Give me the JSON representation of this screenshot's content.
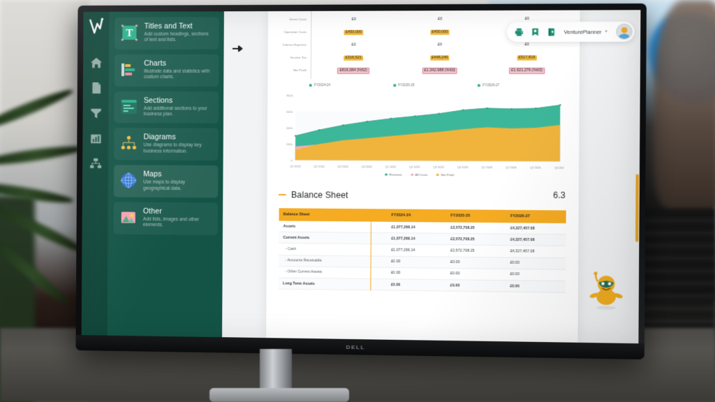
{
  "monitor": {
    "brand": "DELL"
  },
  "sidebar": {
    "rail_icons": [
      "logo-icon",
      "home-icon",
      "document-icon",
      "funnel-icon",
      "bar-chart-icon",
      "org-chart-icon"
    ],
    "items": [
      {
        "title": "Titles and Text",
        "desc": "Add custom headings, sections of text and lists.",
        "icon": "title-block-icon",
        "active": false
      },
      {
        "title": "Charts",
        "desc": "Illustrate data and statistics with custom charts.",
        "icon": "bar-chart-icon",
        "active": false
      },
      {
        "title": "Sections",
        "desc": "Add additional sections to your business plan.",
        "icon": "sections-icon",
        "active": false
      },
      {
        "title": "Diagrams",
        "desc": "Use diagrams to display key business information.",
        "icon": "diagram-icon",
        "active": false
      },
      {
        "title": "Maps",
        "desc": "Use maps to display geographical data.",
        "icon": "globe-icon",
        "active": true
      },
      {
        "title": "Other",
        "desc": "Add lists, images and other elements.",
        "icon": "image-icon",
        "active": false
      }
    ],
    "collapse_label": "‹"
  },
  "toolbar": {
    "print_icon": "printer-icon",
    "save_icon": "save-icon",
    "book_icon": "book-icon",
    "workspace_name": "VenturePlanner",
    "caret": "▾",
    "avatar": "user-avatar"
  },
  "financials": {
    "rows": [
      {
        "label": "Direct Costs",
        "values": [
          "£0",
          "£0",
          "£0"
        ],
        "style": [
          "plain",
          "plain",
          "plain"
        ]
      },
      {
        "label": "Operation Costs",
        "values": [
          "£450,000",
          "£450,000",
          "£0"
        ],
        "style": [
          "amber",
          "amber",
          "plain"
        ]
      },
      {
        "label": "Interest Expense",
        "values": [
          "£0",
          "£0",
          "£0"
        ],
        "style": [
          "plain",
          "plain",
          "plain"
        ]
      },
      {
        "label": "Income Tax",
        "values": [
          "£316,521",
          "£448,246",
          "£517,819"
        ],
        "style": [
          "amber",
          "amber",
          "amber"
        ]
      },
      {
        "label": "Net Profit",
        "values": [
          "£816,084 (%52)",
          "£1,342,988 (%60)",
          "£1,621,276 (%63)"
        ],
        "style": [
          "pink",
          "pink",
          "pink"
        ]
      }
    ]
  },
  "year_legend": [
    {
      "label": "FY2024-24",
      "color": "#2fae84"
    },
    {
      "label": "FY2025-25",
      "color": "#2fae84"
    },
    {
      "label": "FY2026-27",
      "color": "#2fae84"
    }
  ],
  "chart_data": {
    "type": "area",
    "title": "",
    "xlabel": "",
    "ylabel": "",
    "categories": [
      "Q1 2024",
      "Q2 2024",
      "Q3 2024",
      "Q4 2024",
      "Q1 2025",
      "Q2 2025",
      "Q3 2025",
      "Q4 2025",
      "Q1 2026",
      "Q2 2026",
      "Q3 2026",
      "Q4 2026"
    ],
    "ytick_labels": [
      "0",
      "200k",
      "400k",
      "600k",
      "800k"
    ],
    "ylim": [
      0,
      800000
    ],
    "grid": false,
    "legend_position": "bottom",
    "series": [
      {
        "name": "Revenue",
        "color": "#3cb79a",
        "values": [
          300000,
          373000,
          432000,
          478000,
          516000,
          545000,
          577000,
          622000,
          645000,
          637000,
          645000,
          685000
        ]
      },
      {
        "name": "All Costs",
        "color": "#f3aebb",
        "values": [
          170000,
          196000,
          205000,
          210000,
          212000,
          214000,
          216000,
          218000,
          220000,
          222000,
          224000,
          226000
        ]
      },
      {
        "name": "Net Profit",
        "color": "#f0b43c",
        "values": [
          128000,
          200000,
          248000,
          275000,
          302000,
          330000,
          355000,
          390000,
          412000,
          400000,
          408000,
          443000
        ]
      }
    ]
  },
  "balance_section": {
    "number": "6.3",
    "title": "Balance Sheet",
    "table": {
      "headers": [
        "Balance Sheet",
        "FY2024-24",
        "FY2025-25",
        "FY2026-27"
      ],
      "rows": [
        {
          "label": "Assets",
          "bold": true,
          "indent": false,
          "values": [
            "£1,077,266.14",
            "£2,572,708.25",
            "£4,327,457.08"
          ]
        },
        {
          "label": "Current Assets",
          "bold": true,
          "indent": false,
          "values": [
            "£1,077,266.14",
            "£2,572,708.25",
            "£4,327,457.08"
          ]
        },
        {
          "label": "- Cash",
          "bold": false,
          "indent": true,
          "values": [
            "£1,077,266.14",
            "£2,572,708.25",
            "£4,327,457.08"
          ]
        },
        {
          "label": "- Accounts Receivable",
          "bold": false,
          "indent": true,
          "values": [
            "£0.00",
            "£0.00",
            "£0.00"
          ]
        },
        {
          "label": "- Other Current Assets",
          "bold": false,
          "indent": true,
          "values": [
            "£0.00",
            "£0.00",
            "£0.00"
          ]
        },
        {
          "label": "Long Term Assets",
          "bold": true,
          "indent": false,
          "values": [
            "£0.00",
            "£0.00",
            "£0.00"
          ]
        }
      ]
    }
  },
  "mascot": {
    "name": "assistant-robot"
  }
}
